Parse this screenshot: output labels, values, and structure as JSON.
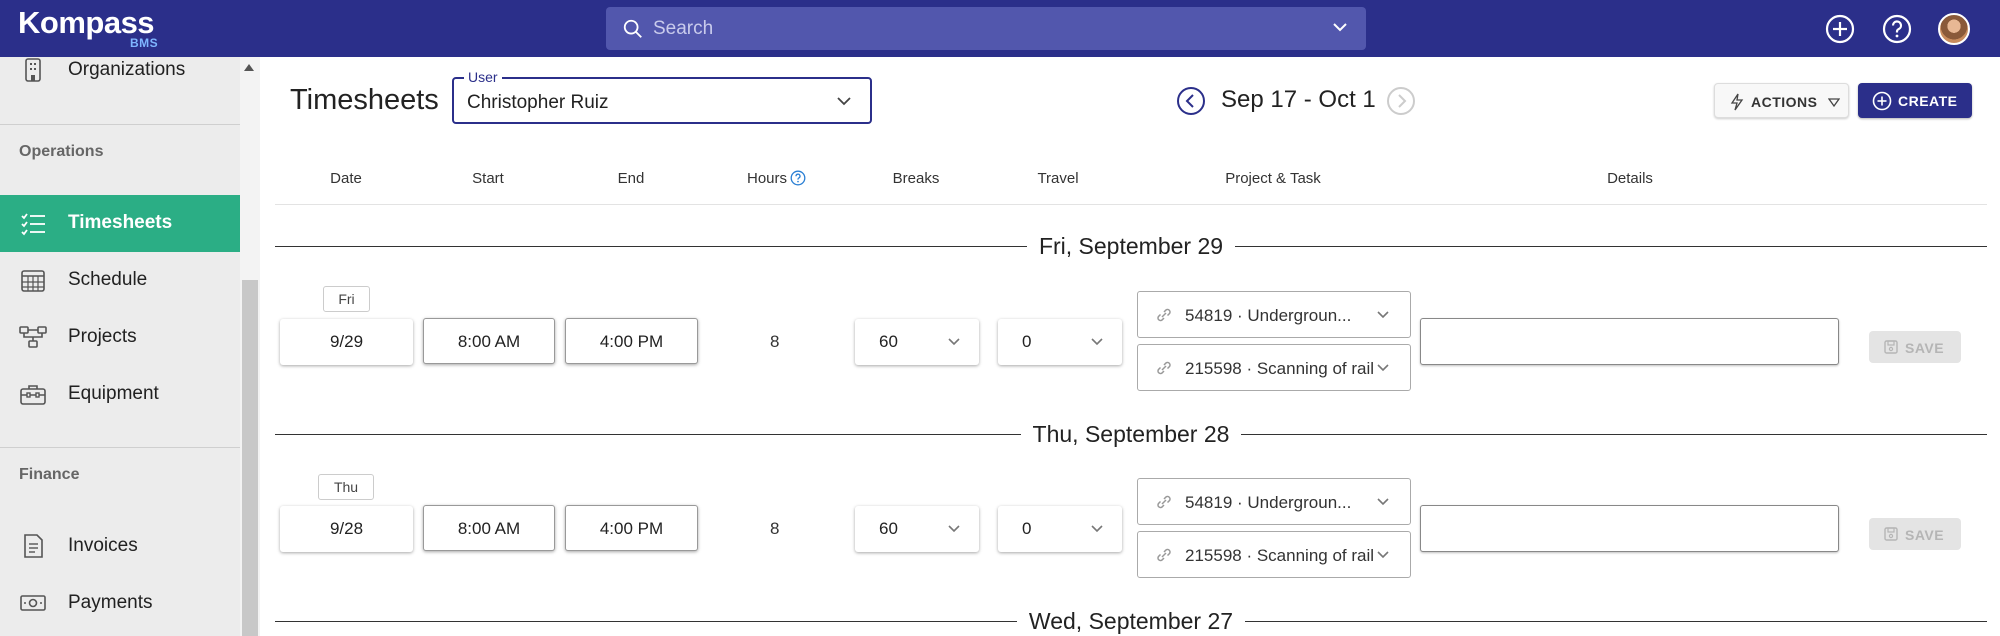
{
  "app": {
    "logo_name": "Kompass",
    "logo_sub": "BMS"
  },
  "search": {
    "placeholder": "Search"
  },
  "sidebar": {
    "items": [
      {
        "label": "Organizations",
        "icon": "building-icon"
      },
      {
        "label": "Timesheets",
        "icon": "checklist-icon",
        "active": true
      },
      {
        "label": "Schedule",
        "icon": "calendar-icon"
      },
      {
        "label": "Projects",
        "icon": "flowchart-icon"
      },
      {
        "label": "Equipment",
        "icon": "toolbox-icon"
      },
      {
        "label": "Invoices",
        "icon": "invoice-icon"
      },
      {
        "label": "Payments",
        "icon": "cash-icon"
      }
    ],
    "sections": {
      "operations": "Operations",
      "finance": "Finance"
    }
  },
  "header": {
    "title": "Timesheets",
    "user_label": "User",
    "user_value": "Christopher Ruiz",
    "date_range": "Sep 17 - Oct 1",
    "actions_label": "ACTIONS",
    "create_label": "CREATE"
  },
  "columns": [
    "Date",
    "Start",
    "End",
    "Hours",
    "Breaks",
    "Travel",
    "Project & Task",
    "Details"
  ],
  "days": [
    {
      "heading": "Fri, September 29",
      "weekday": "Fri",
      "date": "9/29",
      "start": "8:00 AM",
      "end": "4:00 PM",
      "hours": "8",
      "breaks": "60",
      "travel": "0",
      "project": "54819 · Undergroun...",
      "task": "215598 · Scanning of rail",
      "details": "",
      "save_label": "SAVE"
    },
    {
      "heading": "Thu, September 28",
      "weekday": "Thu",
      "date": "9/28",
      "start": "8:00 AM",
      "end": "4:00 PM",
      "hours": "8",
      "breaks": "60",
      "travel": "0",
      "project": "54819 · Undergroun...",
      "task": "215598 · Scanning of rail",
      "details": "",
      "save_label": "SAVE"
    },
    {
      "heading": "Wed, September 27"
    }
  ],
  "colors": {
    "primary": "#2b2f8a",
    "active": "#2bae85",
    "link": "#2a7fd4"
  }
}
